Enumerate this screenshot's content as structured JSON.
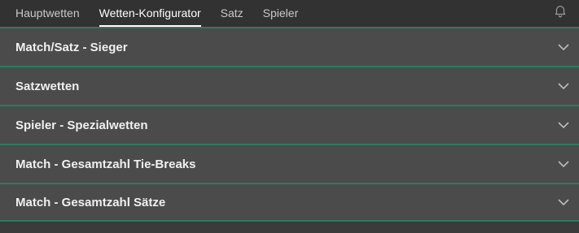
{
  "tabs": [
    {
      "label": "Hauptwetten",
      "active": false
    },
    {
      "label": "Wetten-Konfigurator",
      "active": true
    },
    {
      "label": "Satz",
      "active": false
    },
    {
      "label": "Spieler",
      "active": false
    }
  ],
  "header": {
    "notification_icon": "bell-icon"
  },
  "markets": [
    {
      "title": "Match/Satz - Sieger",
      "icon": "chevron-down-icon"
    },
    {
      "title": "Satzwetten",
      "icon": "chevron-down-icon"
    },
    {
      "title": "Spieler - Spezialwetten",
      "icon": "chevron-down-icon"
    },
    {
      "title": "Match - Gesamtzahl Tie-Breaks",
      "icon": "chevron-down-icon"
    },
    {
      "title": "Match - Gesamtzahl Sätze",
      "icon": "chevron-down-icon"
    }
  ],
  "colors": {
    "accent_divider": "#2f7a5f",
    "tab_underline": "#ffffff",
    "row_bg": "#4b4b4b"
  }
}
